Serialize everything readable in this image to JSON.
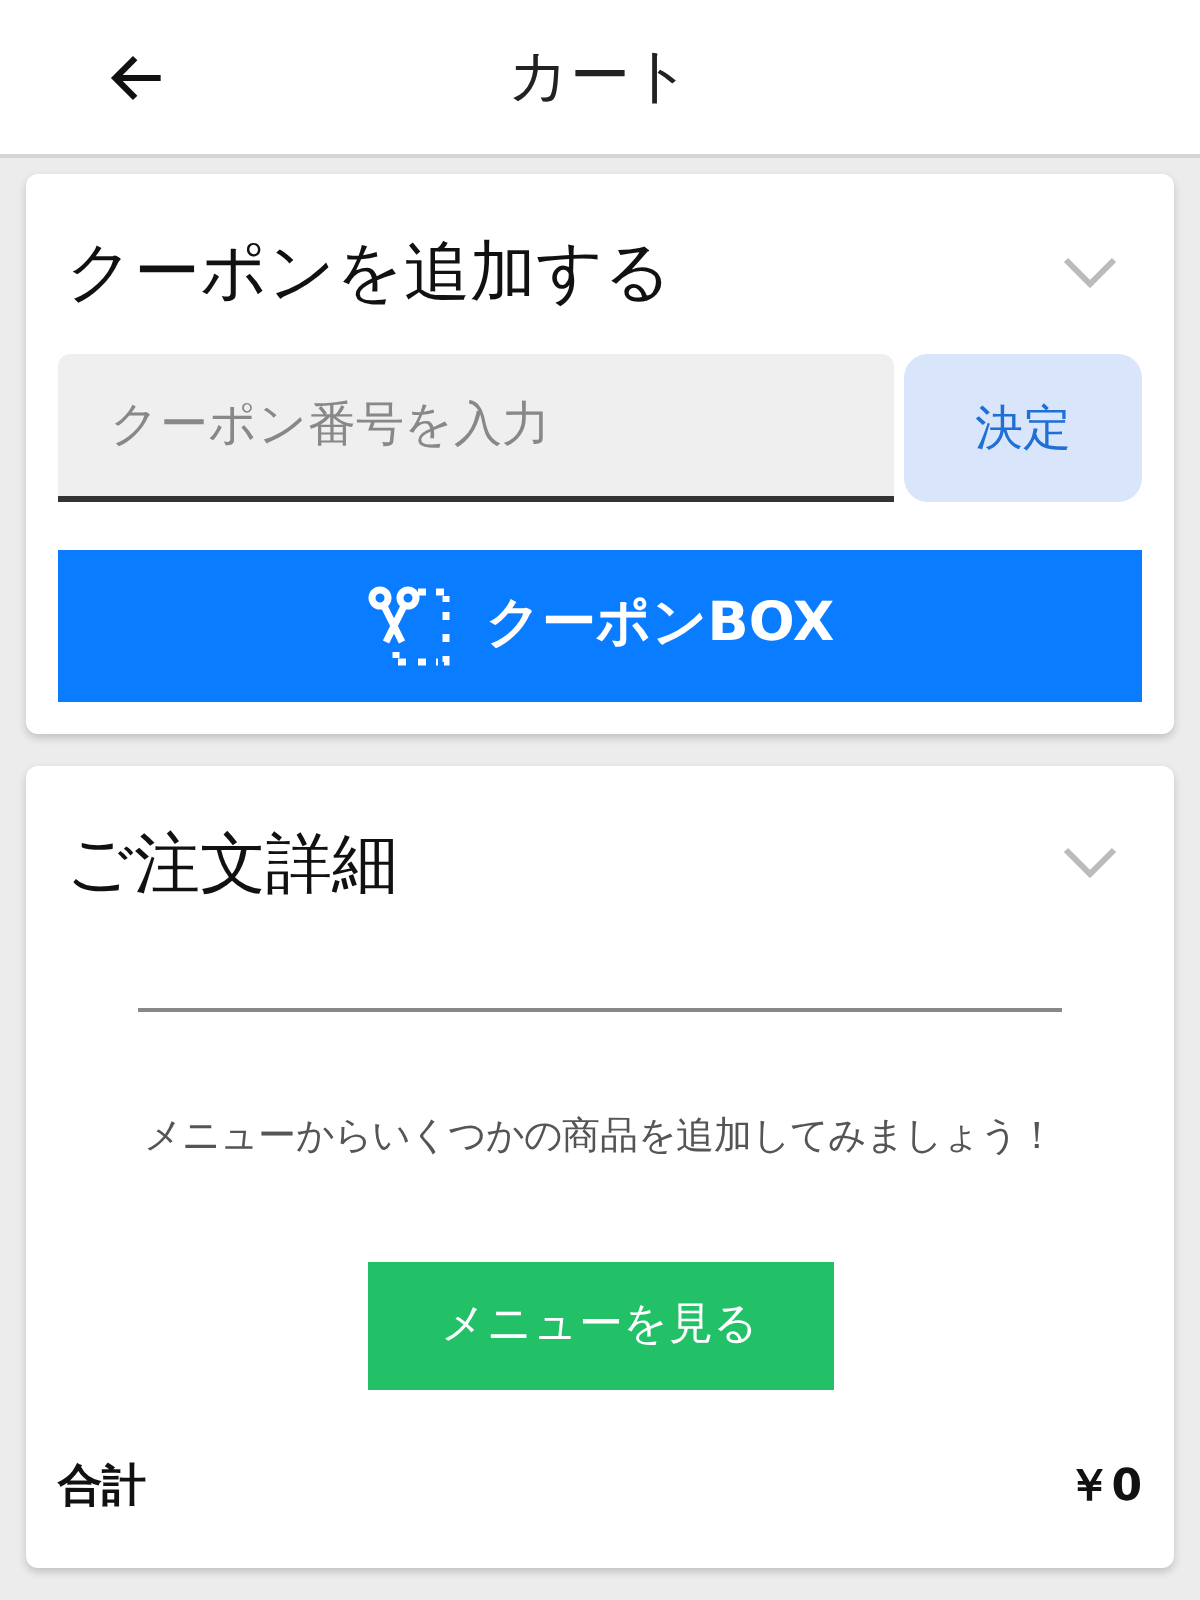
{
  "header": {
    "title": "カート"
  },
  "coupon": {
    "title": "クーポンを追加する",
    "input": {
      "placeholder": "クーポン番号を入力"
    },
    "submit": "決定",
    "box_button": "クーポンBOX"
  },
  "order": {
    "title": "ご注文詳細",
    "empty_message": "メニューからいくつかの商品を追加してみましょう！",
    "menu_button": "メニューを見る",
    "total_label": "合計",
    "total_value": "￥0"
  }
}
